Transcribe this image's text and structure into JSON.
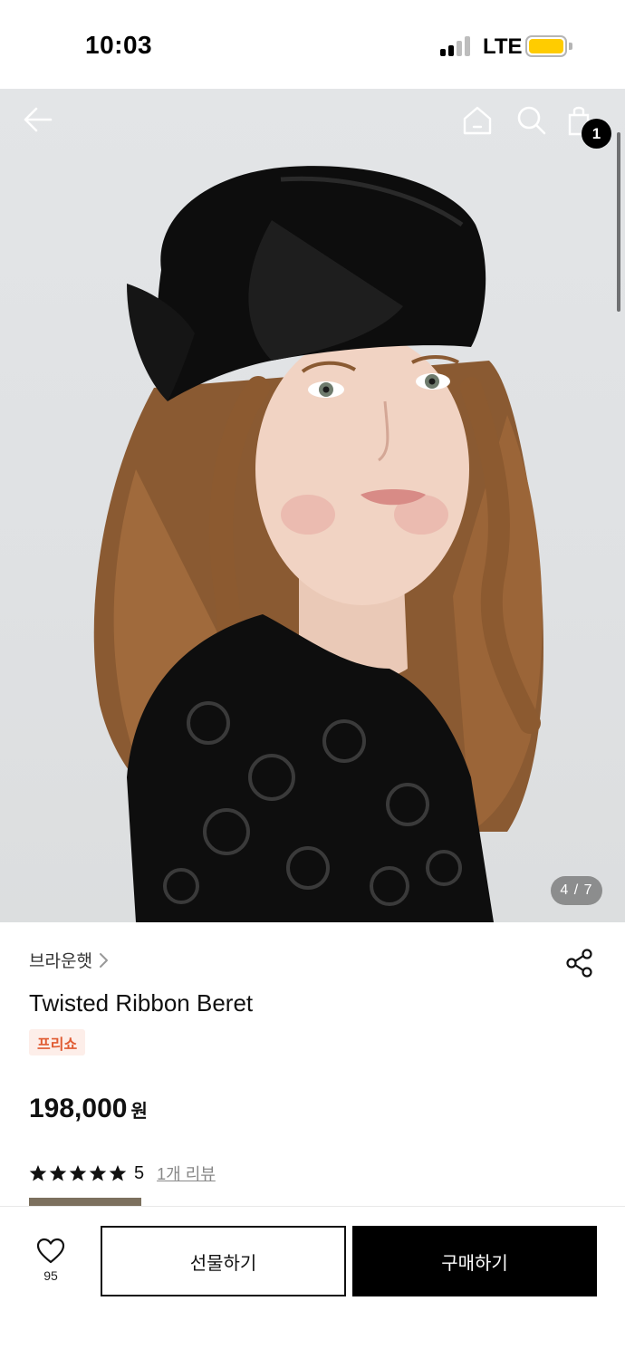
{
  "status_bar": {
    "time": "10:03",
    "network": "LTE"
  },
  "nav": {
    "cart_count": "1"
  },
  "gallery": {
    "page_indicator": "4 / 7"
  },
  "product": {
    "brand": "브라운햇",
    "title": "Twisted Ribbon Beret",
    "tag": "프리쇼",
    "price": "198,000",
    "currency": "원",
    "rating": "5",
    "rating_stars": 5,
    "review_link": "1개 리뷰"
  },
  "bottom_bar": {
    "like_count": "95",
    "gift_label": "선물하기",
    "buy_label": "구매하기"
  },
  "colors": {
    "accent": "#000000",
    "tag_bg": "#fdeee9",
    "tag_text": "#e05b32",
    "battery": "#ffcc00"
  },
  "icons": [
    "back-arrow-icon",
    "home-icon",
    "search-icon",
    "shopping-bag-icon",
    "chevron-right-icon",
    "share-icon",
    "star-icon",
    "heart-icon"
  ]
}
